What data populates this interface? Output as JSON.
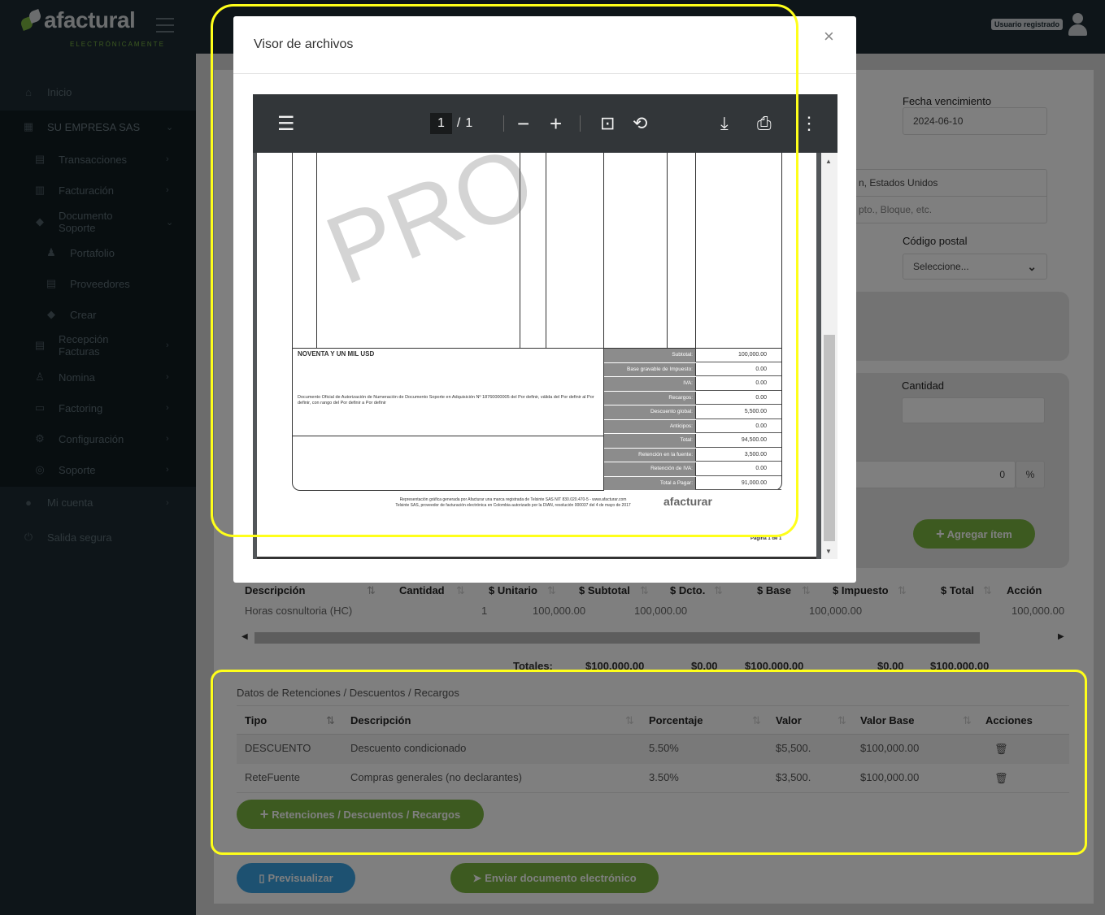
{
  "topbar": {
    "logo": "afactural",
    "logo_sub": "ELECTRÓNICAMENTE",
    "user_badge": "Usuario registrado",
    "colors": {
      "dark": "#1c2b33",
      "green": "#7ab540"
    }
  },
  "sidebar": {
    "items": [
      {
        "label": "Inicio",
        "icon": "home-icon"
      },
      {
        "label": "SU EMPRESA SAS",
        "icon": "building-icon"
      },
      {
        "label": "Transacciones",
        "icon": "clipboard-icon"
      },
      {
        "label": "Facturación",
        "icon": "invoice-icon"
      },
      {
        "label": "Documento Soporte",
        "icon": "tags-icon"
      },
      {
        "label": "Portafolio",
        "icon": "users-icon"
      },
      {
        "label": "Proveedores",
        "icon": "clipboard-icon"
      },
      {
        "label": "Crear",
        "icon": "tags-icon"
      },
      {
        "label": "Recepción Facturas",
        "icon": "clipboard-icon"
      },
      {
        "label": "Nomina",
        "icon": "person-icon"
      },
      {
        "label": "Factoring",
        "icon": "money-icon"
      },
      {
        "label": "Configuración",
        "icon": "gear-icon"
      },
      {
        "label": "Soporte",
        "icon": "lifebuoy-icon"
      },
      {
        "label": "Mi cuenta",
        "icon": "user-icon"
      },
      {
        "label": "Salida segura",
        "icon": "power-icon"
      }
    ]
  },
  "form": {
    "fecha_label": "Fecha vencimiento",
    "fecha_value": "2024-06-10",
    "address_value": "n, Estados Unidos",
    "address2_placeholder": "pto., Bloque, etc.",
    "postal_label": "Código postal",
    "postal_value": "Seleccione...",
    "cantidad_label": "Cantidad",
    "pct_value": "0",
    "pct_symbol": "%",
    "add_item": "Agregar ítem"
  },
  "items_table": {
    "headers": [
      "Descripción",
      "Cantidad",
      "$ Unitario",
      "$ Subtotal",
      "$ Dcto.",
      "$ Base",
      "$ Impuesto",
      "$ Total",
      "Acción"
    ],
    "row": {
      "desc": "Horas cosnultoria (HC)",
      "cantidad": "1",
      "unitario": "100,000.00",
      "subtotal": "100,000.00",
      "base": "100,000.00",
      "total": "100,000.00"
    },
    "totals_label": "Totales:",
    "totals": [
      "$100,000.00",
      "$0.00",
      "$100,000.00",
      "$0.00",
      "$100,000.00"
    ]
  },
  "retenciones": {
    "title": "Datos de Retenciones / Descuentos / Recargos",
    "headers": [
      "Tipo",
      "Descripción",
      "Porcentaje",
      "Valor",
      "Valor Base",
      "Acciones"
    ],
    "rows": [
      {
        "tipo": "DESCUENTO",
        "desc": "Descuento condicionado",
        "pct": "5.50%",
        "valor": "$5,500.",
        "base": "$100,000.00"
      },
      {
        "tipo": "ReteFuente",
        "desc": "Compras generales (no declarantes)",
        "pct": "3.50%",
        "valor": "$3,500.",
        "base": "$100,000.00"
      }
    ],
    "add_button": "Retenciones / Descuentos / Recargos"
  },
  "actions": {
    "preview": "Previsualizar",
    "send": "Enviar documento electrónico"
  },
  "modal": {
    "title": "Visor de archivos",
    "close": "×",
    "pdf": {
      "page_current": "1",
      "page_sep": "/",
      "page_total": "1"
    },
    "invoice": {
      "watermark": "PRO",
      "amount_words": "NOVENTA Y UN MIL USD",
      "legal": "Documento Oficial de Autorización de Numeración de Documento Soporte en Adquisición Nº 18760000005 del Por definir, válida del Por definir al Por definir, con rango del Por definir a Por definir",
      "summary": [
        {
          "label": "Subtotal:",
          "value": "100,000.00"
        },
        {
          "label": "Base gravable de Impuesto:",
          "value": "0.00"
        },
        {
          "label": "IVA:",
          "value": "0.00"
        },
        {
          "label": "Recargos:",
          "value": "0.00"
        },
        {
          "label": "Descuento global:",
          "value": "5,500.00"
        },
        {
          "label": "Anticipos:",
          "value": "0.00"
        },
        {
          "label": "Total:",
          "value": "94,500.00"
        },
        {
          "label": "Retención en la fuente:",
          "value": "3,500.00"
        },
        {
          "label": "Retención de IVA:",
          "value": "0.00"
        },
        {
          "label": "Total a Pagar:",
          "value": "91,000.00"
        }
      ],
      "footer1": "Representación gráfica generada por Afacturar una marca registrada de Telsinte SAS NIT 830.020.470-5 - www.afacturar.com",
      "footer2": "Telsinte SAS, proveedor de facturación electrónica en Colombia autorizado por la DIAN, resolución 000037 del 4 de mayo de 2017",
      "footer_logo": "afacturar",
      "page_label": "Página 1 de 1"
    }
  }
}
